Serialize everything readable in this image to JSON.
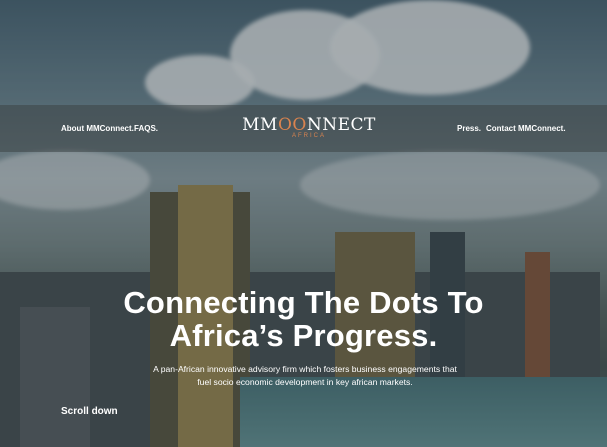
{
  "nav": {
    "left_links": [
      "About MMConnect.",
      "FAQS."
    ],
    "right_links": [
      "Press.",
      "Contact MMConnect."
    ]
  },
  "logo": {
    "text_before": "MM",
    "text_mid": "OO",
    "text_after": "NNECT",
    "sub": "AFRICA"
  },
  "hero": {
    "headline_line1": "Connecting The Dots To",
    "headline_line2": "Africa’s Progress.",
    "subtext_line1": "A pan-African innovative advisory firm which fosters business engagements that",
    "subtext_line2": "fuel socio economic development in key african markets.",
    "scroll_label": "Scroll down"
  },
  "colors": {
    "accent": "#d9834f"
  }
}
